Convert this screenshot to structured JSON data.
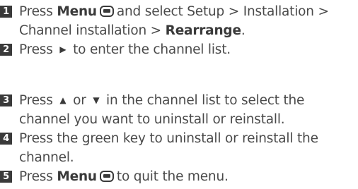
{
  "steps": [
    {
      "number": "1",
      "pre": "Press",
      "menu": "Menu",
      "mid": "and select Setup > Installation > Channel installation >",
      "bold_end": "Rearrange",
      "end": "."
    },
    {
      "number": "2",
      "pre": "Press",
      "arrow": "▶",
      "post": "to enter the channel list."
    },
    {
      "number": "3",
      "pre": "Press",
      "arrow_up": "▲",
      "or": "or",
      "arrow_down": "▼",
      "post": "in the channel list to select the channel you want to uninstall or reinstall."
    },
    {
      "number": "4",
      "text": "Press the green key to uninstall or reinstall the channel."
    },
    {
      "number": "5",
      "pre": "Press",
      "menu": "Menu",
      "post": "to quit the menu."
    }
  ],
  "icons": {
    "menu_button": "menu-button-icon",
    "right_arrow": "right-arrow-icon",
    "up_arrow": "up-arrow-icon",
    "down_arrow": "down-arrow-icon"
  }
}
